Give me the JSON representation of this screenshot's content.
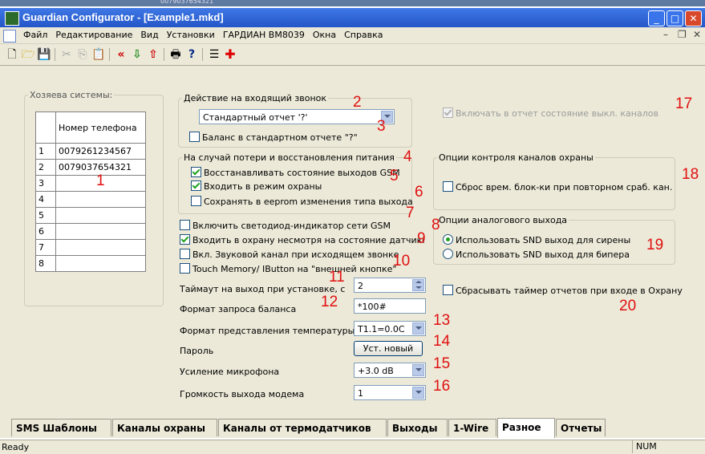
{
  "window": {
    "title": "Guardian Configurator - [Example1.mkd]"
  },
  "top_strip_text": "0079037654321",
  "menu": [
    "Файл",
    "Редактирование",
    "Вид",
    "Установки",
    "ГАРДИАН ВМ8039",
    "Окна",
    "Справка"
  ],
  "hosts": {
    "title": "Хозяева системы:",
    "column_header": "Номер телефона",
    "rows": [
      {
        "n": "1",
        "phone": "0079261234567"
      },
      {
        "n": "2",
        "phone": "0079037654321"
      },
      {
        "n": "3",
        "phone": ""
      },
      {
        "n": "4",
        "phone": ""
      },
      {
        "n": "5",
        "phone": ""
      },
      {
        "n": "6",
        "phone": ""
      },
      {
        "n": "7",
        "phone": ""
      },
      {
        "n": "8",
        "phone": ""
      }
    ]
  },
  "incoming_call": {
    "title": "Действие на входящий звонок",
    "selected": "Стандартный отчет '?'",
    "balance_in_report": "Баланс в стандартном отчете \"?\"",
    "balance_checked": false
  },
  "power_loss": {
    "title": "На случай потери и восстановления питания",
    "restore_outputs": "Восстанавливать состояние выходов GSM",
    "restore_outputs_checked": true,
    "arm_mode": "Входить в режим охраны",
    "arm_mode_checked": true,
    "save_eeprom": "Сохранять в eeprom изменения типа выхода",
    "save_eeprom_checked": false
  },
  "options": {
    "gsm_led": "Включить светодиод-индикатор сети GSM",
    "gsm_led_checked": false,
    "arm_despite": "Входить в охрану несмотря на состояние датчиков",
    "arm_despite_checked": true,
    "voice_channel": "Вкл. Звуковой канал при исходящем звонке",
    "voice_channel_checked": false,
    "touch_memory": "Touch Memory/ IButton на \"внешней кнопке\"",
    "touch_memory_checked": false
  },
  "settings": {
    "exit_timeout_label": "Таймаут на выход при установке, с",
    "exit_timeout_value": "2",
    "balance_format_label": "Формат запроса баланса",
    "balance_format_value": "*100#",
    "temp_format_label": "Формат представления температуры",
    "temp_format_value": "T1.1=0.0C",
    "password_label": "Пароль",
    "password_button": "Уст. новый",
    "mic_gain_label": "Усиление микрофона",
    "mic_gain_value": "+3.0 dB",
    "modem_volume_label": "Громкость выхода модема",
    "modem_volume_value": "1"
  },
  "right": {
    "include_off_channels": "Включать в отчет состояние выкл. каналов",
    "include_off_channels_checked": true,
    "control_title": "Опции контроля каналов охраны",
    "reset_block": "Сброс врем. блок-ки при повторном сраб. кан.",
    "reset_block_checked": false,
    "analog_title": "Опции аналогового выхода",
    "snd_siren": "Использовать SND выход для сирены",
    "snd_beeper": "Использовать SND выход для бипера",
    "snd_selected": "siren",
    "reset_timer": "Сбрасывать таймер отчетов при входе в Охрану",
    "reset_timer_checked": false
  },
  "annotations": [
    "1",
    "2",
    "3",
    "4",
    "5",
    "6",
    "7",
    "8",
    "9",
    "10",
    "11",
    "12",
    "13",
    "14",
    "15",
    "16",
    "17",
    "18",
    "19",
    "20"
  ],
  "tabs": [
    "SMS Шаблоны",
    "Каналы охраны",
    "Каналы от термодатчиков",
    "Выходы",
    "1-Wire",
    "Разное",
    "Отчеты"
  ],
  "active_tab": "Разное",
  "status": {
    "text": "Ready",
    "num": "NUM"
  },
  "colors": {
    "title_bar": "#2456c8",
    "annotation": "#e01010",
    "check": "#21a121"
  }
}
